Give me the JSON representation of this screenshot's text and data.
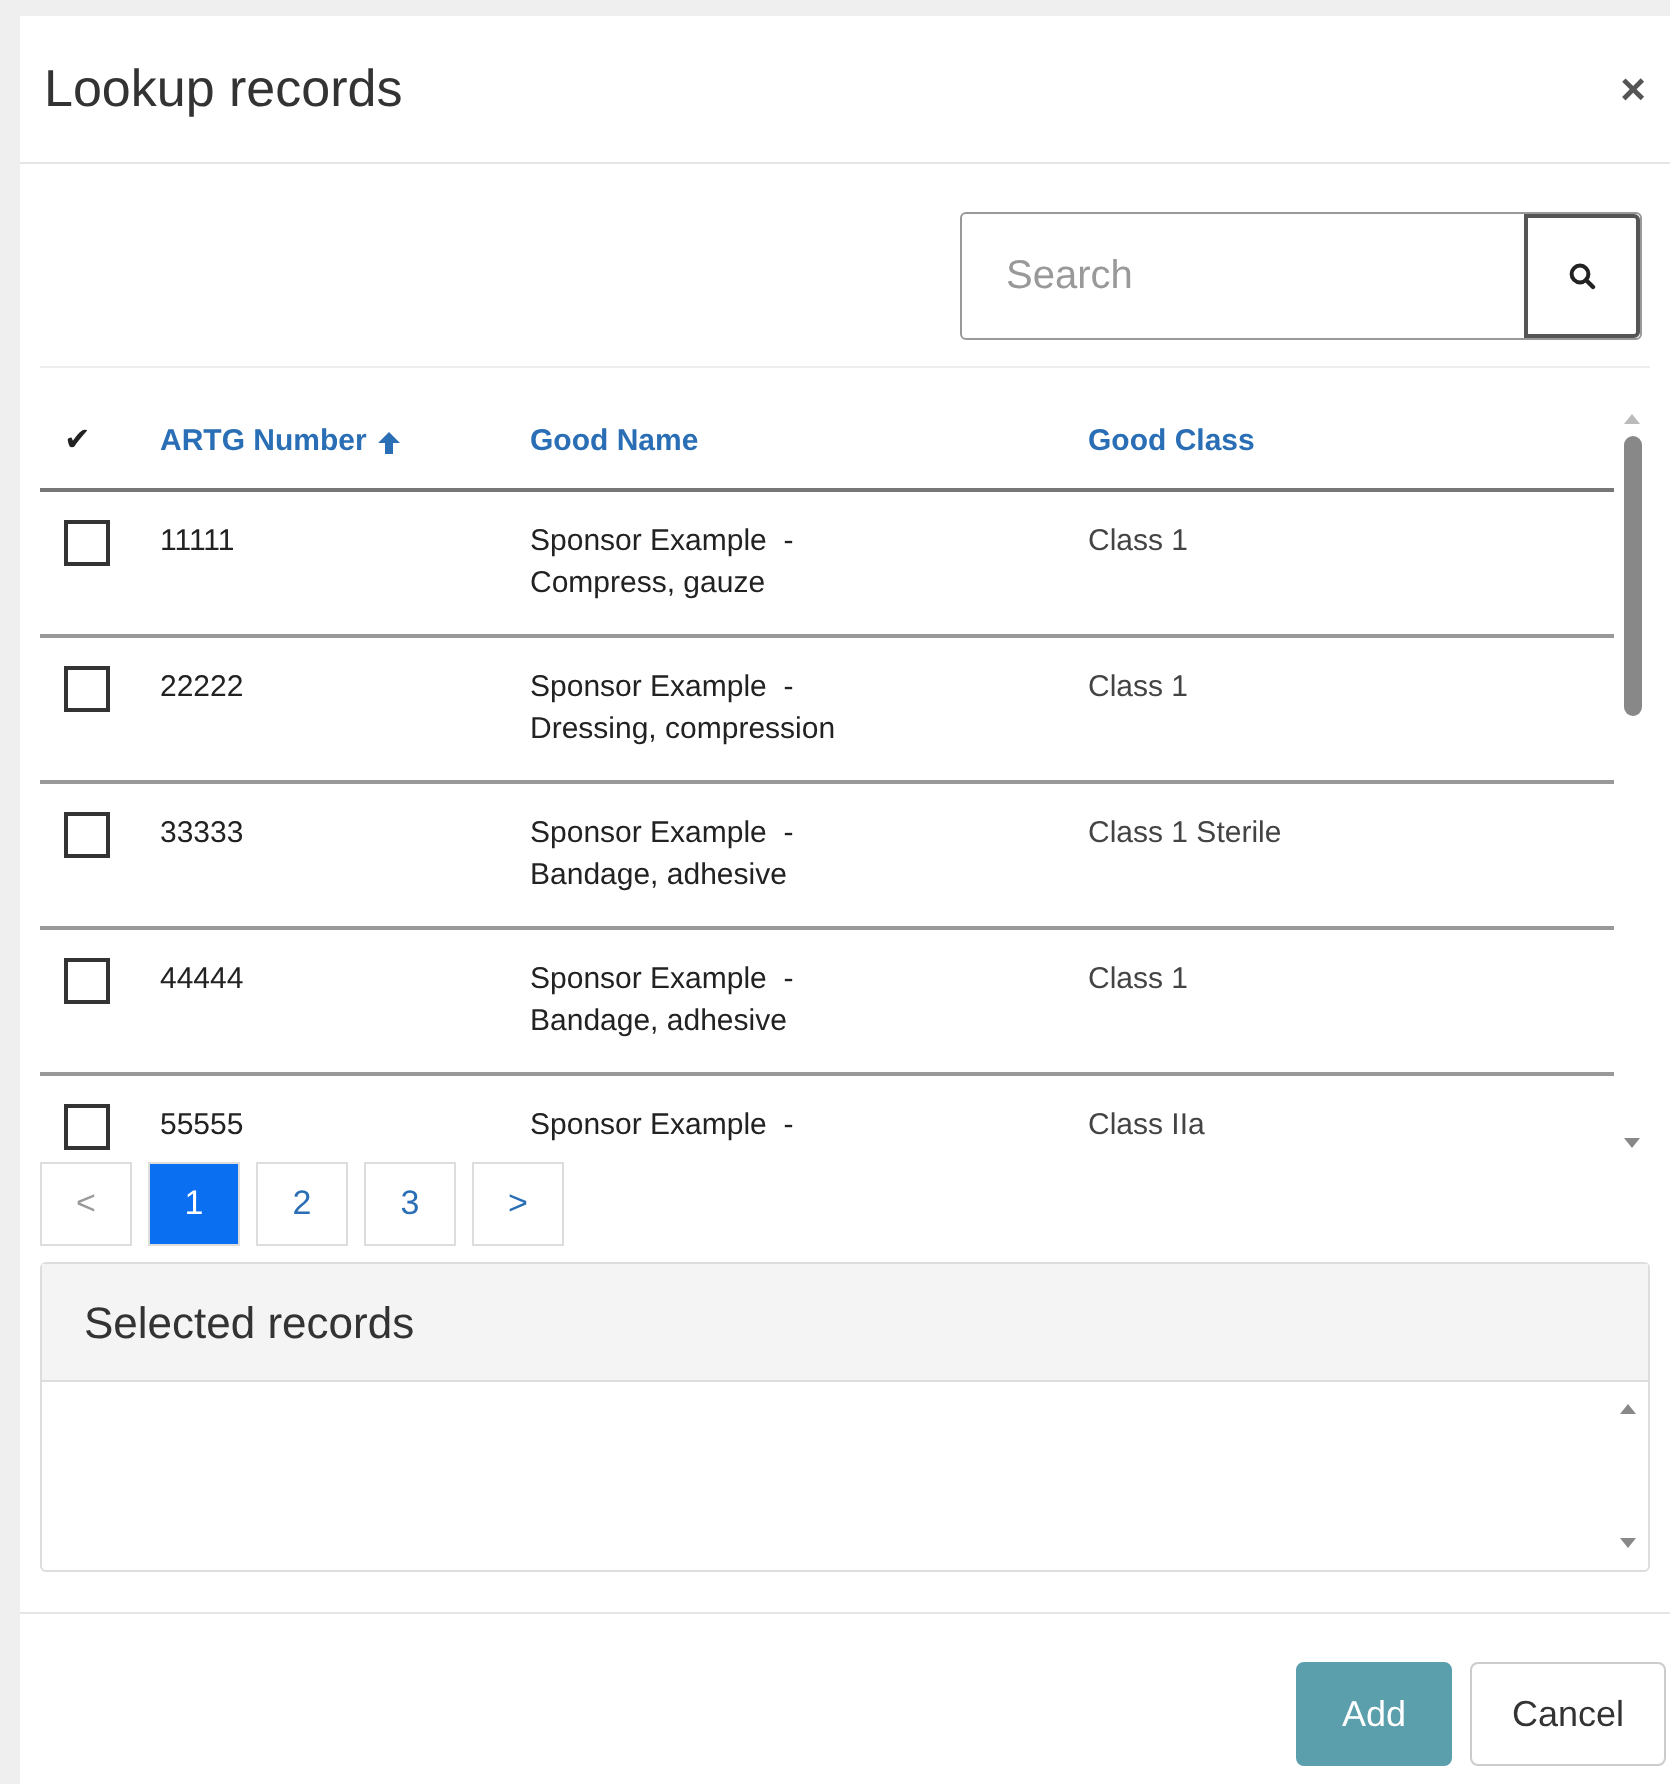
{
  "dialog": {
    "title": "Lookup records",
    "close": "×"
  },
  "search": {
    "placeholder": "Search"
  },
  "table": {
    "select_all": "✔",
    "columns": [
      {
        "label": "ARTG Number",
        "sorted": true
      },
      {
        "label": "Good Name",
        "sorted": false
      },
      {
        "label": "Good Class",
        "sorted": false
      }
    ],
    "rows": [
      {
        "checked": false,
        "number": "11111",
        "name": [
          "Sponsor Example  -",
          "Compress, gauze"
        ],
        "class": "Class 1"
      },
      {
        "checked": false,
        "number": "22222",
        "name": [
          "Sponsor Example  -",
          "Dressing, compression"
        ],
        "class": "Class 1"
      },
      {
        "checked": false,
        "number": "33333",
        "name": [
          "Sponsor Example  -",
          "Bandage, adhesive"
        ],
        "class": "Class 1 Sterile"
      },
      {
        "checked": false,
        "number": "44444",
        "name": [
          "Sponsor Example  -",
          "Bandage, adhesive"
        ],
        "class": "Class 1"
      },
      {
        "checked": false,
        "number": "55555",
        "name": [
          "Sponsor Example  -"
        ],
        "class": "Class IIa"
      }
    ]
  },
  "pagination": {
    "previous": "<",
    "next": ">",
    "pages": [
      {
        "label": "1",
        "selected": true
      },
      {
        "label": "2",
        "selected": false
      },
      {
        "label": "3",
        "selected": false
      }
    ]
  },
  "selected_records": {
    "title": "Selected records"
  },
  "buttons": [
    {
      "label": "Add",
      "kind": "primary"
    },
    {
      "label": "Cancel",
      "kind": "secondary"
    }
  ]
}
